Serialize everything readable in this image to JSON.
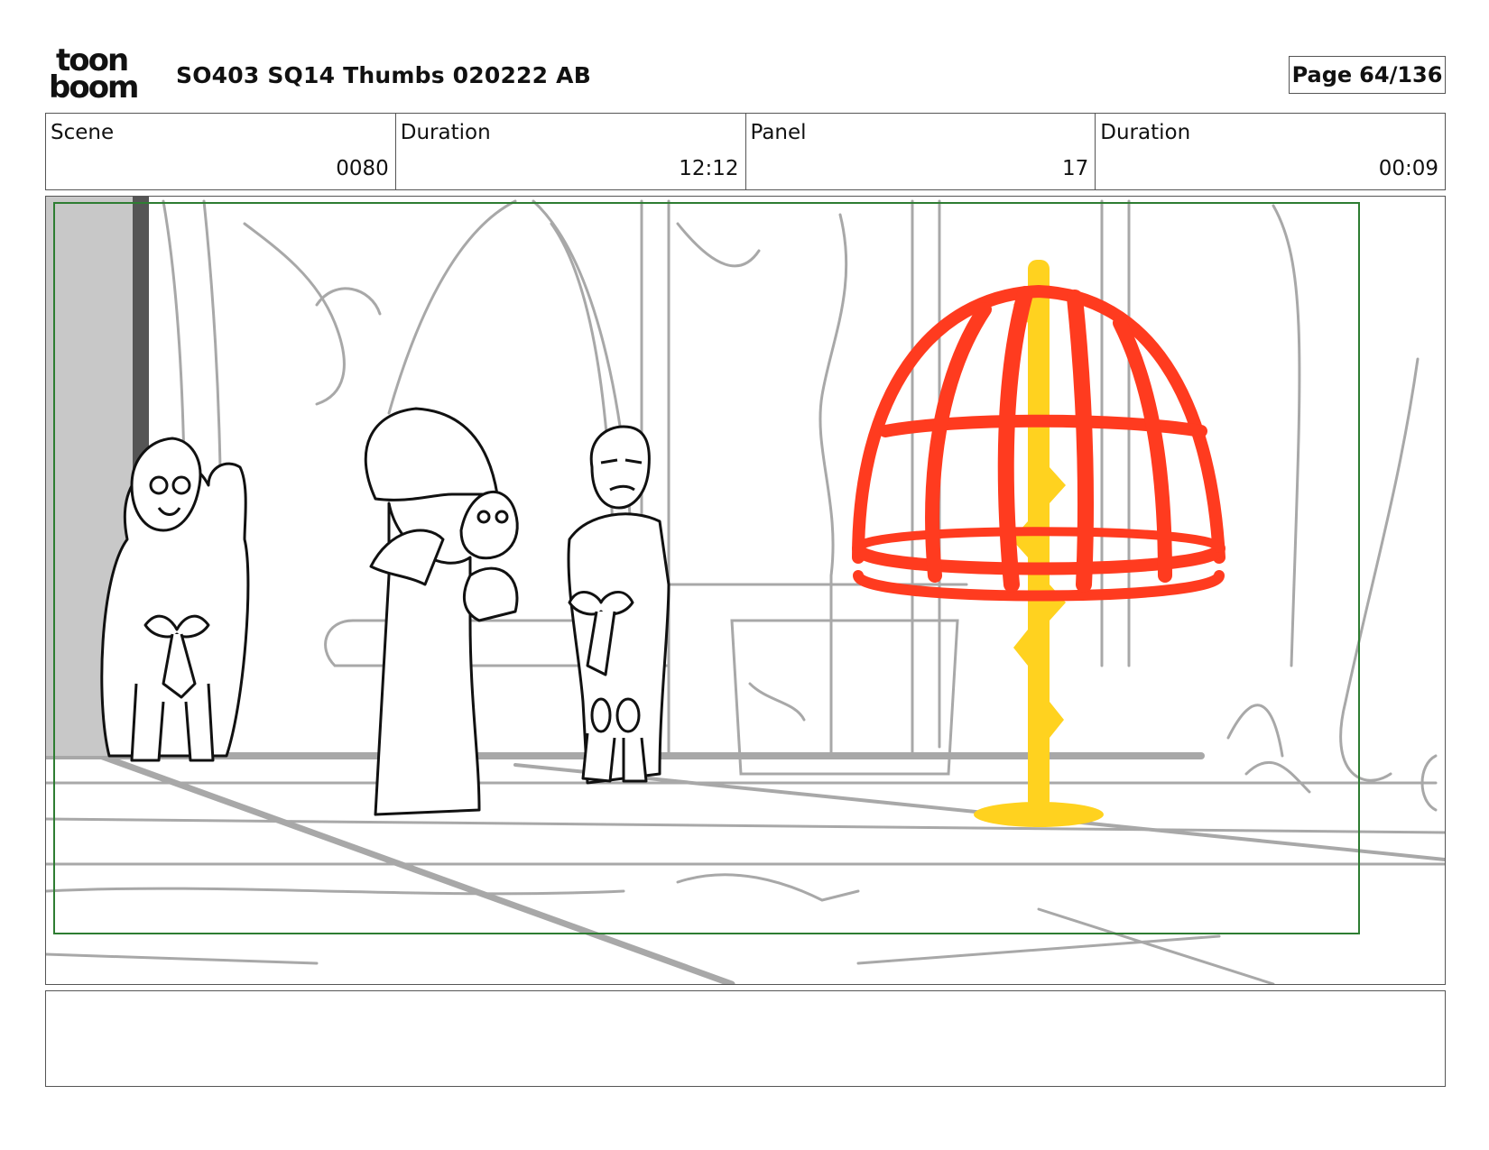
{
  "header": {
    "logo_top": "toon",
    "logo_bottom": "boom",
    "title": "SO403 SQ14 Thumbs 020222 AB",
    "page_label": "Page",
    "page_value": "64/136"
  },
  "info": {
    "scene_label": "Scene",
    "scene_value": "0080",
    "scene_duration_label": "Duration",
    "scene_duration_value": "12:12",
    "panel_label": "Panel",
    "panel_value": "17",
    "panel_duration_label": "Duration",
    "panel_duration_value": "00:09"
  },
  "colors": {
    "cage": "#ff3b1f",
    "pole": "#ffd21f",
    "safe_frame": "#2e7d32",
    "background_lines": "#a8a8a8"
  }
}
